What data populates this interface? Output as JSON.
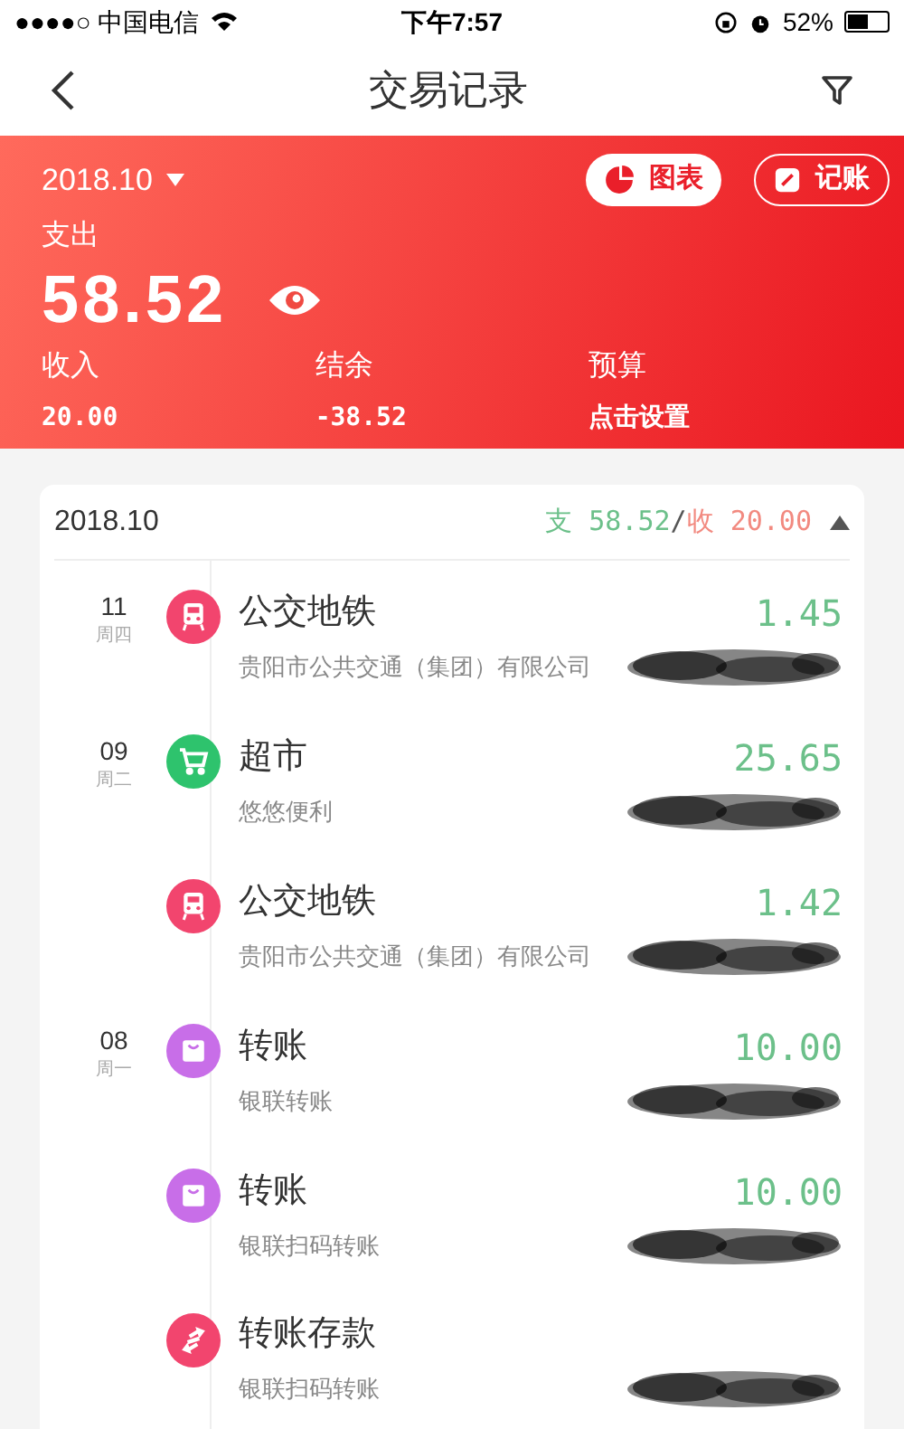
{
  "status_bar": {
    "carrier": "●●●●○ 中国电信",
    "time": "下午7:57",
    "battery": "52%"
  },
  "nav": {
    "title": "交易记录"
  },
  "summary": {
    "month": "2018.10",
    "chart_button": "图表",
    "record_button": "记账",
    "expense_label": "支出",
    "expense": "58.52",
    "stats": [
      {
        "label": "收入",
        "value": "20.00"
      },
      {
        "label": "结余",
        "value": "-38.52"
      },
      {
        "label": "预算",
        "value": "点击设置"
      }
    ]
  },
  "month_group": {
    "month": "2018.10",
    "expense_prefix": "支",
    "expense": "58.52",
    "separator": "/",
    "income_prefix": "收",
    "income": "20.00",
    "expanded": true,
    "transactions": [
      {
        "day": "11",
        "weekday": "周四",
        "kind": "transit",
        "color": "#f2456e",
        "title": "公交地铁",
        "merchant": "贵阳市公共交通（集团）有限公司",
        "amount": "1.45",
        "redacted": true
      },
      {
        "day": "09",
        "weekday": "周二",
        "kind": "shopping",
        "color": "#2ec36d",
        "title": "超市",
        "merchant": "悠悠便利",
        "amount": "25.65",
        "redacted": true
      },
      {
        "kind": "transit",
        "color": "#f2456e",
        "title": "公交地铁",
        "merchant": "贵阳市公共交通（集团）有限公司",
        "amount": "1.42",
        "redacted": true
      },
      {
        "day": "08",
        "weekday": "周一",
        "kind": "bag",
        "color": "#c86ee8",
        "title": "转账",
        "merchant": "银联转账",
        "amount": "10.00",
        "redacted": true
      },
      {
        "kind": "bag",
        "color": "#c86ee8",
        "title": "转账",
        "merchant": "银联扫码转账",
        "amount": "10.00",
        "redacted": true
      },
      {
        "kind": "exchange",
        "color": "#f2456e",
        "title": "转账存款",
        "merchant": "银联扫码转账",
        "redacted": true
      }
    ]
  }
}
